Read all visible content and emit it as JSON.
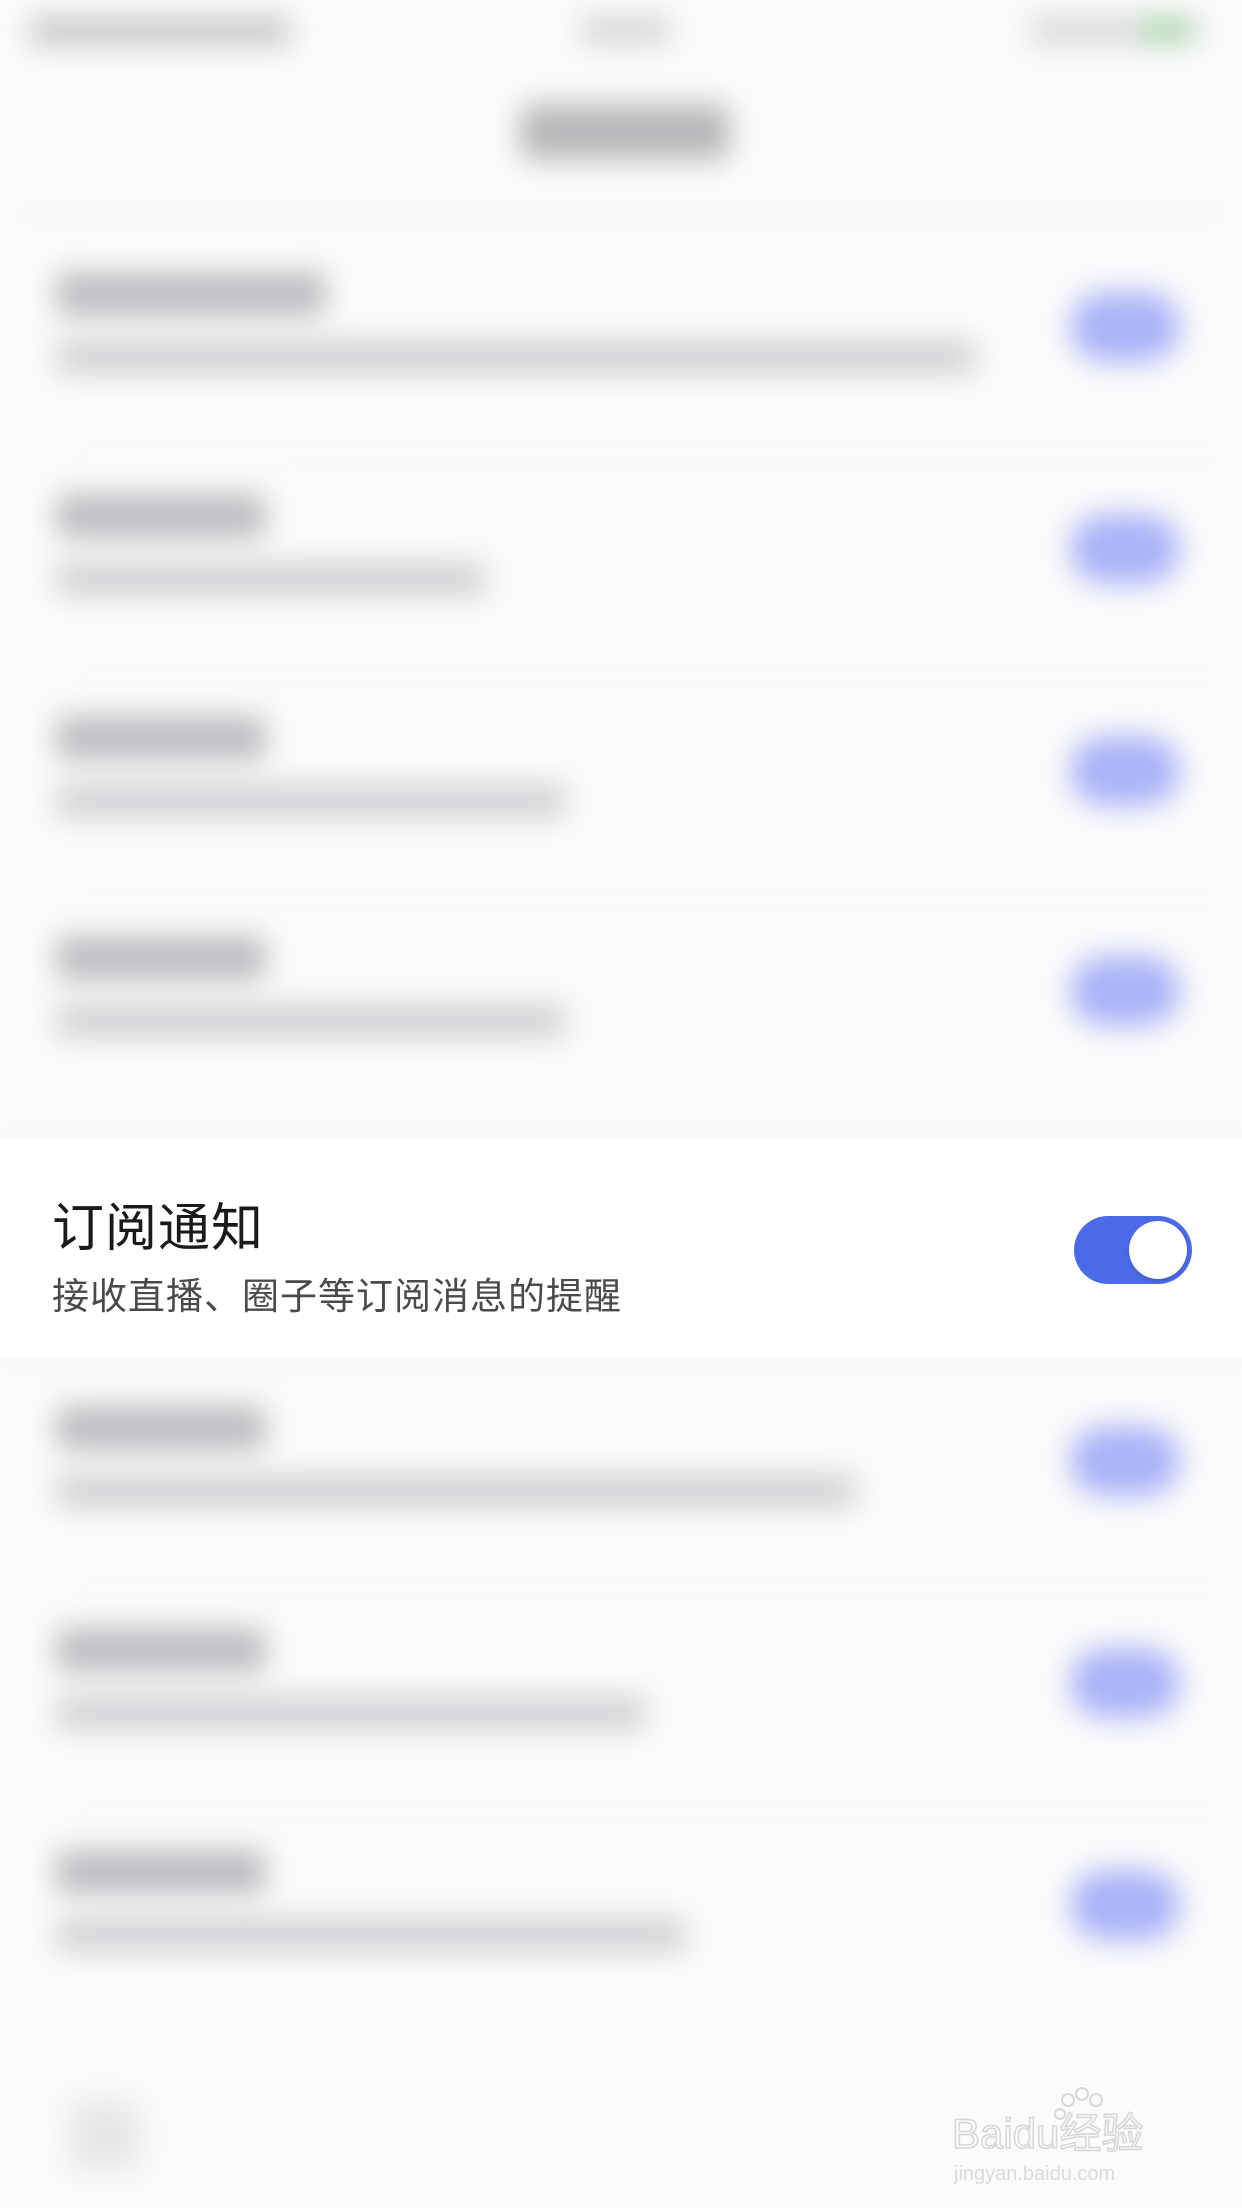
{
  "subscription_setting": {
    "title": "订阅通知",
    "description": "接收直播、圈子等订阅消息的提醒",
    "toggle_on": true
  },
  "colors": {
    "toggle_on": "#4b6ae6",
    "background": "#fbfbfc"
  },
  "watermark": {
    "brand": "Baidu经验",
    "url": "jingyan.baidu.com"
  }
}
